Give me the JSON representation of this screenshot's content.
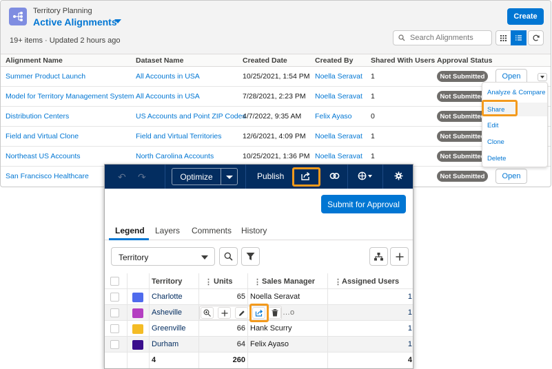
{
  "list_view": {
    "object_label": "Territory Planning",
    "title": "Active Alignments",
    "meta": "19+ items  ·  Updated 2 hours ago",
    "create_label": "Create",
    "search_placeholder": "Search Alignments",
    "icons": {
      "object": "hierarchy-icon",
      "grid_view": "grid-icon",
      "list_view": "list-icon",
      "refresh": "refresh-icon"
    },
    "columns": [
      "Alignment Name",
      "Dataset Name",
      "Created Date",
      "Created By",
      "Shared With Users",
      "Approval Status"
    ],
    "rows": [
      {
        "name": "Summer Product Launch",
        "dataset": "All Accounts in USA",
        "created": "10/25/2021, 1:54 PM",
        "by": "Noella Seravat",
        "shared": "1",
        "status": "Not Submitted",
        "open": "Open"
      },
      {
        "name": "Model for Territory Management System",
        "dataset": "All Accounts in USA",
        "created": "7/28/2021, 2:23 PM",
        "by": "Noella Seravat",
        "shared": "1",
        "status": "Not Submitted",
        "open": ""
      },
      {
        "name": "Distribution Centers",
        "dataset": "US Accounts and Point ZIP Codes",
        "created": "4/7/2022, 9:35 AM",
        "by": "Felix Ayaso",
        "shared": "0",
        "status": "Not Submitted",
        "open": ""
      },
      {
        "name": "Field and Virtual Clone",
        "dataset": "Field and Virtual Territories",
        "created": "12/6/2021, 4:09 PM",
        "by": "Noella Seravat",
        "shared": "1",
        "status": "Not Submitted",
        "open": ""
      },
      {
        "name": "Northeast US Accounts",
        "dataset": "North Carolina Accounts",
        "created": "10/25/2021, 1:36 PM",
        "by": "Noella Seravat",
        "shared": "1",
        "status": "Not Submitted",
        "open": ""
      },
      {
        "name": "San Francisco Healthcare",
        "dataset": "",
        "created": "",
        "by": "",
        "shared": "",
        "status": "Not Submitted",
        "open": "Open"
      }
    ],
    "row_menu": [
      "Analyze & Compare",
      "Share",
      "Edit",
      "Clone",
      "Delete"
    ]
  },
  "editor": {
    "toolbar": {
      "optimize_label": "Optimize",
      "publish_label": "Publish",
      "icons": [
        "undo-icon",
        "redo-icon",
        "share-icon",
        "link-icon",
        "globe-icon",
        "settings-icon"
      ]
    },
    "submit_label": "Submit for Approval",
    "tabs": [
      "Legend",
      "Layers",
      "Comments",
      "History"
    ],
    "active_tab": "Legend",
    "select_value": "Territory",
    "table": {
      "headers": [
        "Territory",
        "Units",
        "Sales Manager",
        "Assigned Users"
      ],
      "rows": [
        {
          "territory": "Charlotte",
          "units": "65",
          "manager": "Noella Seravat",
          "users": "1",
          "color": "#4f6bed"
        },
        {
          "territory": "Asheville",
          "units": "",
          "manager": "…o",
          "users": "1",
          "color": "#b43fc1"
        },
        {
          "territory": "Greenville",
          "units": "66",
          "manager": "Hank Scurry",
          "users": "1",
          "color": "#f4bc25"
        },
        {
          "territory": "Durham",
          "units": "64",
          "manager": "Felix Ayaso",
          "users": "1",
          "color": "#3a0e8c"
        }
      ],
      "totals": {
        "territory": "4",
        "units": "260",
        "users": "4"
      }
    }
  },
  "highlight_color": "#f39a1d"
}
